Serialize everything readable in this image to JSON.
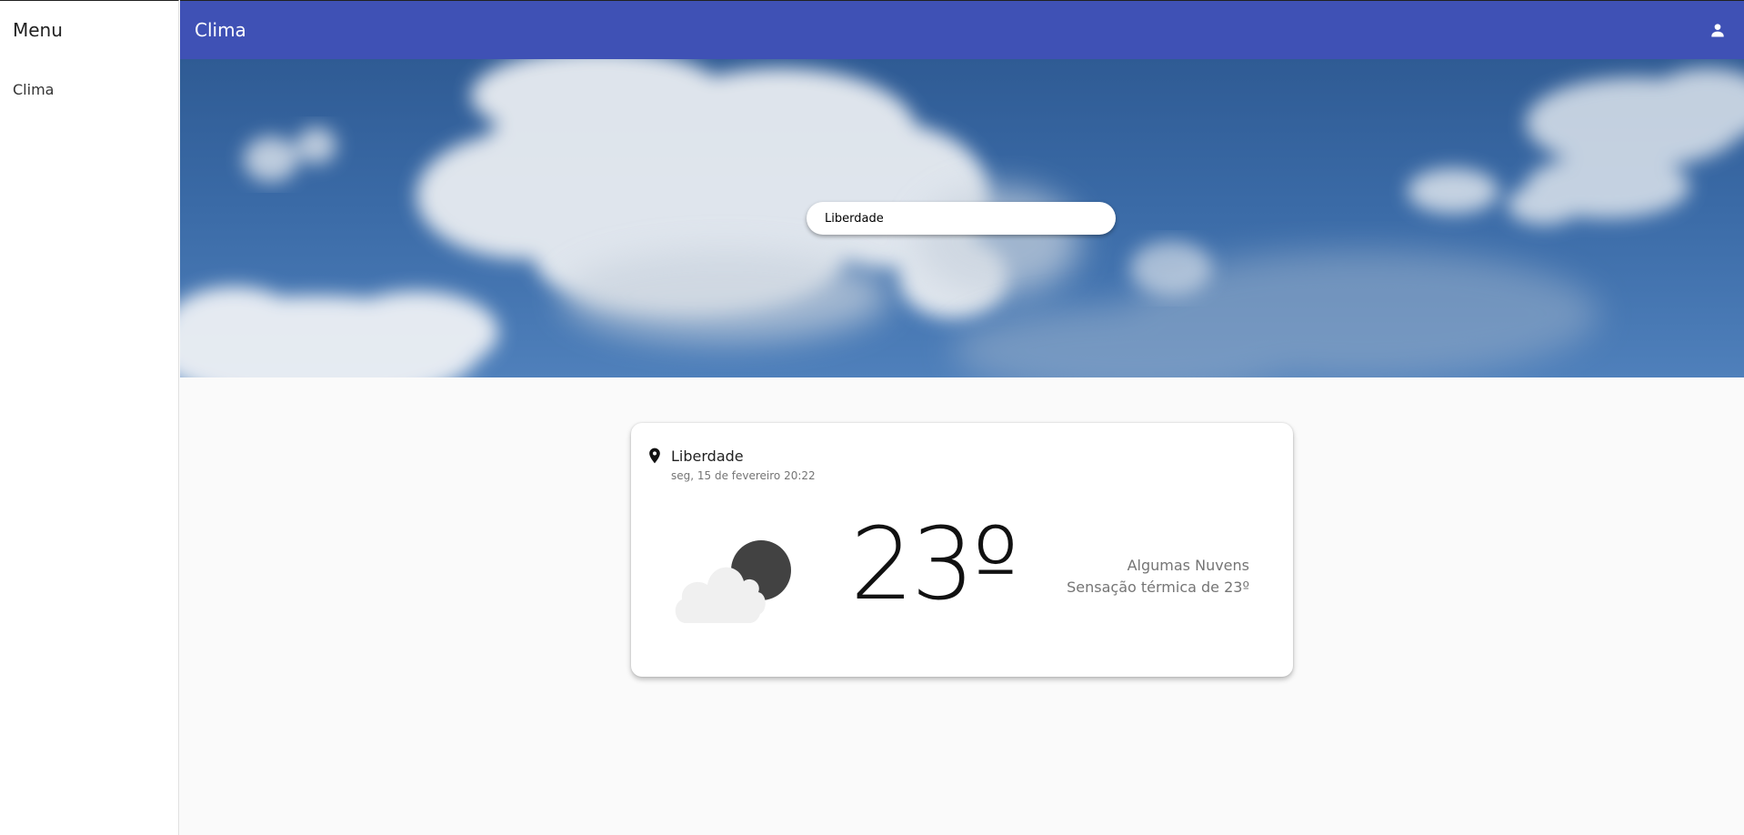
{
  "sidebar": {
    "title": "Menu",
    "items": [
      {
        "label": "Clima"
      }
    ]
  },
  "topbar": {
    "title": "Clima",
    "account_icon": "account-icon"
  },
  "search": {
    "value": "Liberdade"
  },
  "weather": {
    "location": "Liberdade",
    "datetime": "seg, 15 de fevereiro 20:22",
    "temperature": "23",
    "unit": "º",
    "condition": "Algumas Nuvens",
    "feels_like": "Sensação térmica de 23º",
    "icon": "cloudy-night-icon"
  },
  "colors": {
    "primary": "#3f51b5",
    "background": "#fafafa",
    "card": "#ffffff"
  }
}
